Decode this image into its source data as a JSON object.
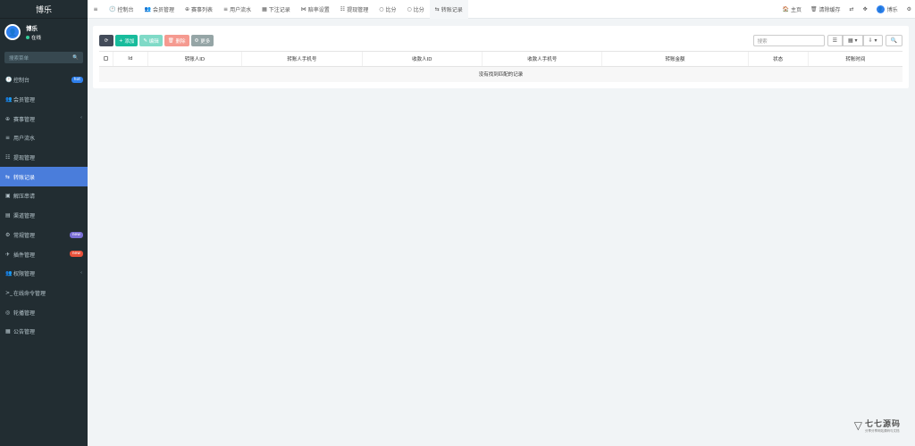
{
  "app": {
    "logo": "博乐"
  },
  "user": {
    "name": "博乐",
    "status": "在线"
  },
  "sidebar": {
    "search_placeholder": "搜索菜单",
    "items": [
      {
        "label": "控制台",
        "icon": "🕐",
        "badge": "hot",
        "badge_color": "#2f80ed"
      },
      {
        "label": "会员管理",
        "icon": "👥"
      },
      {
        "label": "赛事管理",
        "icon": "⊕",
        "chevron": "‹"
      },
      {
        "label": "用户流水",
        "icon": "≡"
      },
      {
        "label": "提现管理",
        "icon": "☷"
      },
      {
        "label": "转账记录",
        "icon": "⇆",
        "active": true
      },
      {
        "label": "解压串请",
        "icon": "▣"
      },
      {
        "label": "渠道管理",
        "icon": "▤"
      },
      {
        "label": "常规管理",
        "icon": "⚙",
        "badge": "new",
        "badge_color": "#7a6fd4"
      },
      {
        "label": "插件管理",
        "icon": "✈",
        "badge": "new",
        "badge_color": "#e8503a"
      },
      {
        "label": "权限管理",
        "icon": "👥",
        "chevron": "‹"
      },
      {
        "label": "在线命令管理",
        "icon": ">_"
      },
      {
        "label": "轮播管理",
        "icon": "◎"
      },
      {
        "label": "公告管理",
        "icon": "▦"
      }
    ]
  },
  "topnav": {
    "tabs": [
      {
        "label": "控制台",
        "icon": "🕐"
      },
      {
        "label": "会员管理",
        "icon": "👥"
      },
      {
        "label": "赛事列表",
        "icon": "⊕"
      },
      {
        "label": "用户流水",
        "icon": "≡"
      },
      {
        "label": "下注记录",
        "icon": "▦"
      },
      {
        "label": "赔率设置",
        "icon": "⋈"
      },
      {
        "label": "提现管理",
        "icon": "☷"
      },
      {
        "label": "比分",
        "icon": "○"
      },
      {
        "label": "比分",
        "icon": "○"
      },
      {
        "label": "转账记录",
        "icon": "⇆",
        "active": true
      }
    ],
    "right": {
      "home": "主页",
      "clear_cache": "清除缓存",
      "username": "博乐"
    }
  },
  "toolbar": {
    "add": "添加",
    "edit": "编辑",
    "delete": "删除",
    "more": "更多",
    "search_placeholder": "搜索"
  },
  "table": {
    "headers": [
      "Id",
      "转账人ID",
      "转账人手机号",
      "收款人ID",
      "收款人手机号",
      "转账金额",
      "状态",
      "转账时间"
    ],
    "empty_text": "没有找到匹配的记录"
  },
  "watermark": {
    "title": "七七源码",
    "subtitle": "分享分享网站源码与文档"
  }
}
